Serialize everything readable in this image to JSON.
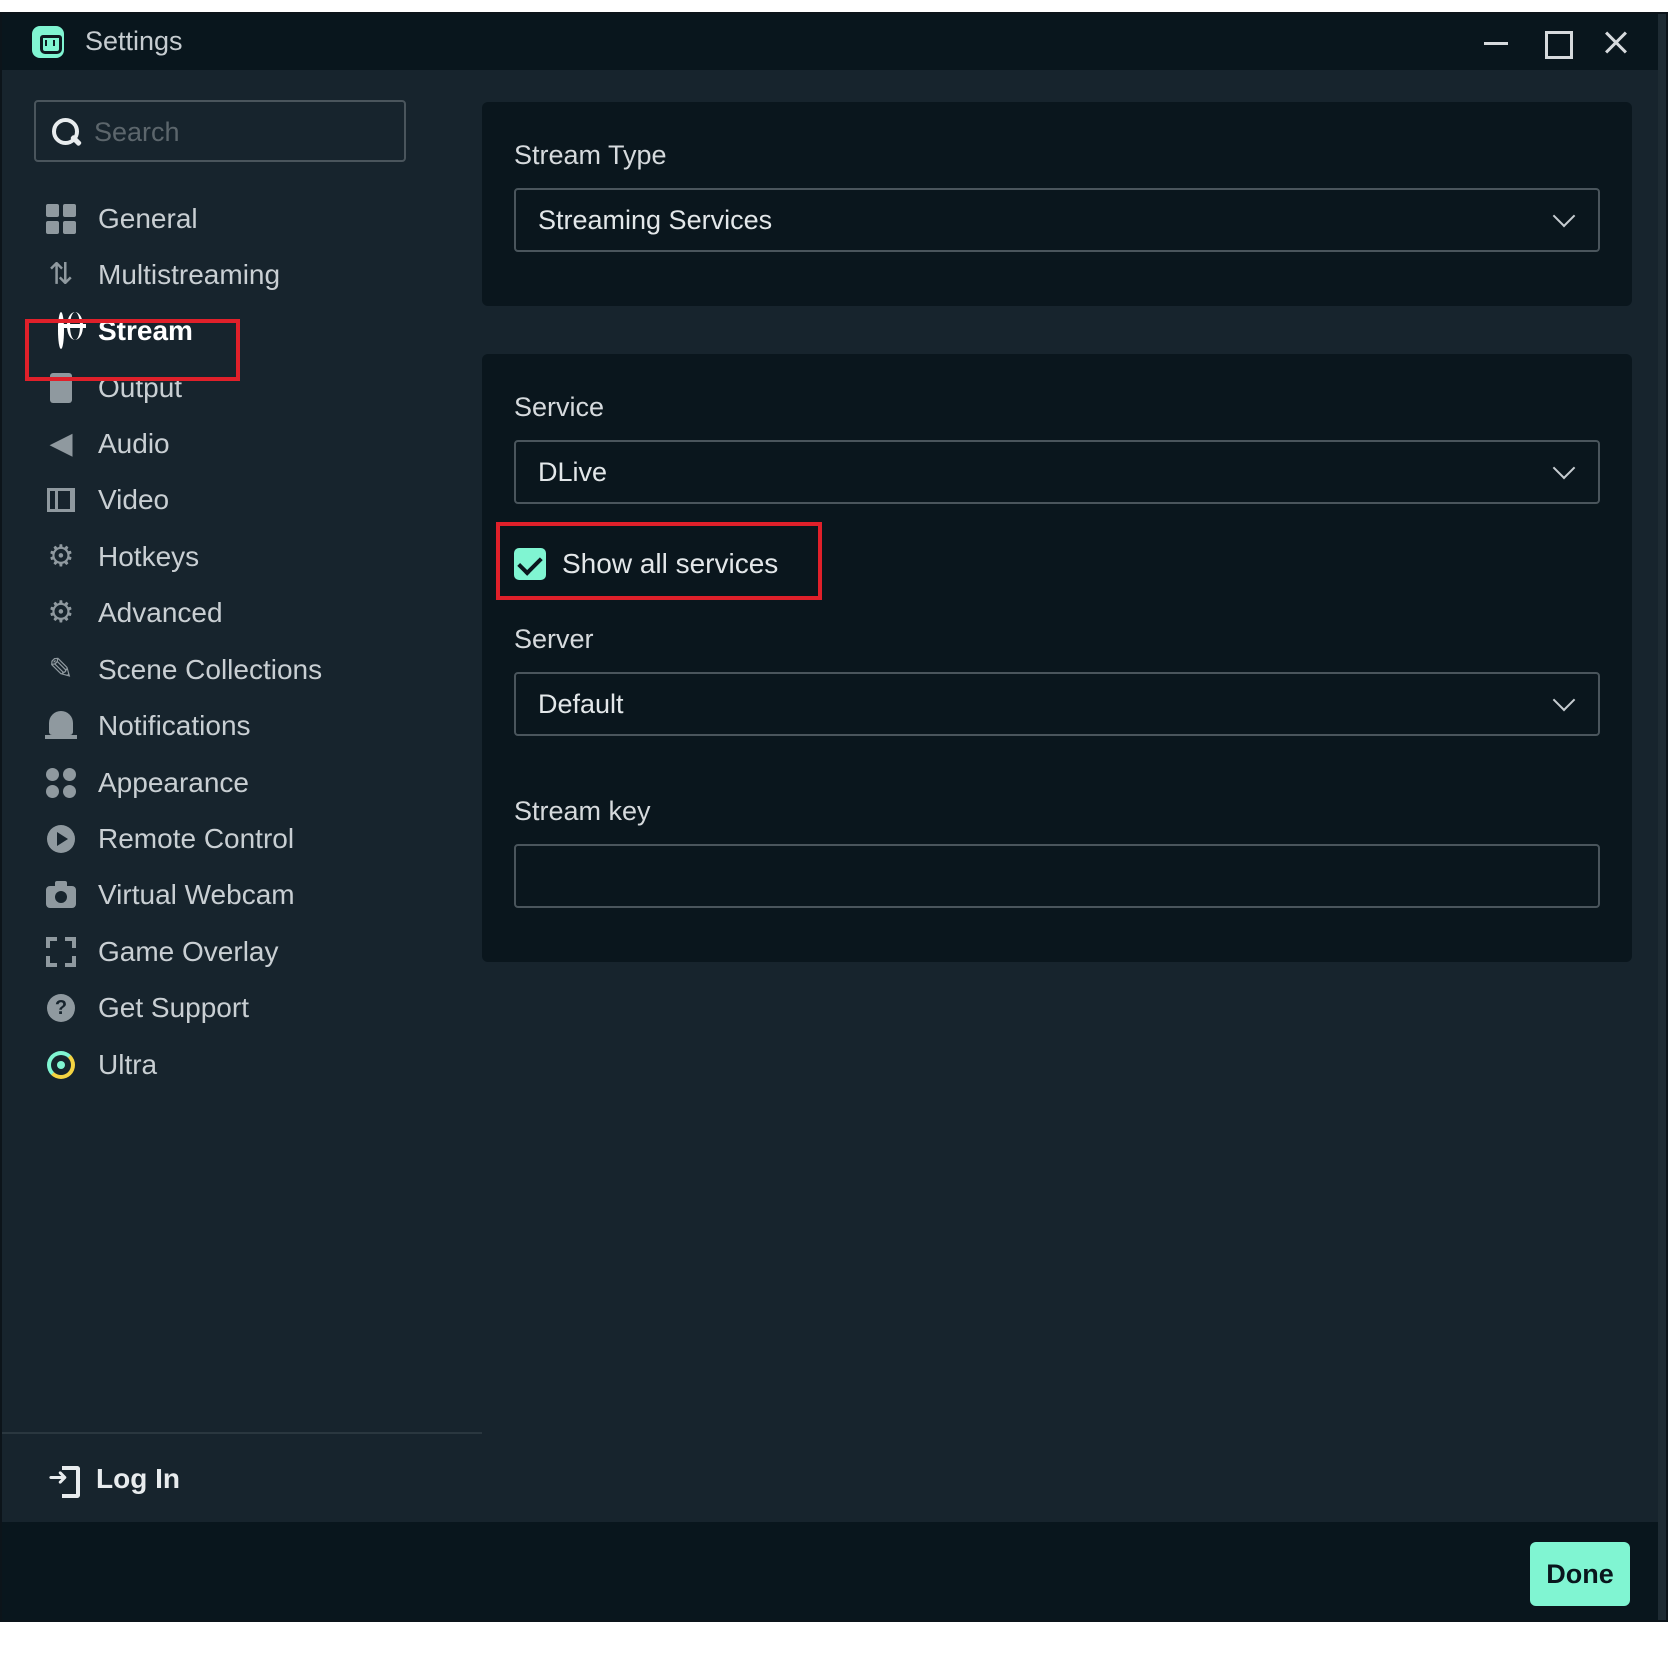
{
  "window": {
    "title": "Settings"
  },
  "search": {
    "placeholder": "Search",
    "value": ""
  },
  "sidebar": {
    "items": [
      {
        "label": "General",
        "icon": "grid-icon"
      },
      {
        "label": "Multistreaming",
        "icon": "multistream-icon"
      },
      {
        "label": "Stream",
        "icon": "globe-icon",
        "active": true
      },
      {
        "label": "Output",
        "icon": "output-icon"
      },
      {
        "label": "Audio",
        "icon": "speaker-icon"
      },
      {
        "label": "Video",
        "icon": "film-icon"
      },
      {
        "label": "Hotkeys",
        "icon": "gear-icon"
      },
      {
        "label": "Advanced",
        "icon": "gears-icon"
      },
      {
        "label": "Scene Collections",
        "icon": "scene-collections-icon"
      },
      {
        "label": "Notifications",
        "icon": "bell-icon"
      },
      {
        "label": "Appearance",
        "icon": "appearance-icon"
      },
      {
        "label": "Remote Control",
        "icon": "play-circle-icon"
      },
      {
        "label": "Virtual Webcam",
        "icon": "camera-icon"
      },
      {
        "label": "Game Overlay",
        "icon": "expand-icon"
      },
      {
        "label": "Get Support",
        "icon": "help-icon"
      },
      {
        "label": "Ultra",
        "icon": "ultra-icon"
      }
    ],
    "login_label": "Log In"
  },
  "stream_type": {
    "label": "Stream Type",
    "value": "Streaming Services"
  },
  "service": {
    "label": "Service",
    "value": "DLive"
  },
  "show_all_services": {
    "label": "Show all services",
    "checked": true
  },
  "server": {
    "label": "Server",
    "value": "Default"
  },
  "stream_key": {
    "label": "Stream key",
    "value": ""
  },
  "footer": {
    "done_label": "Done"
  },
  "colors": {
    "accent": "#80f5d2",
    "background": "#17242d",
    "card": "#0a161d",
    "highlight": "#e0202a"
  }
}
